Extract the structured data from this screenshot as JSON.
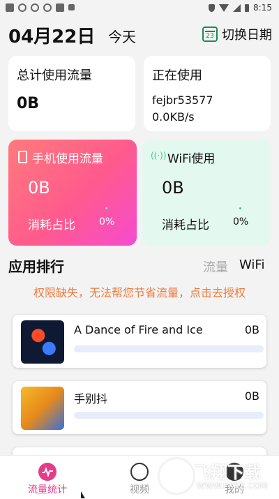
{
  "status_bar": {
    "time": "8:15"
  },
  "header": {
    "date": "04月22日",
    "today": "今天",
    "switch_label": "切换日期",
    "calendar_num": "23"
  },
  "total_card": {
    "title": "总计使用流量",
    "value": "0B"
  },
  "using_card": {
    "title": "正在使用",
    "network": "fejbr53577",
    "speed": "0.0KB/s"
  },
  "mobile_card": {
    "title": "手机使用流量",
    "value": "0B",
    "ratio_label": "消耗占比",
    "ratio_value": "0%"
  },
  "wifi_card": {
    "title": "WiFi使用",
    "value": "0B",
    "ratio_label": "消耗占比",
    "ratio_value": "0%"
  },
  "ranking": {
    "title": "应用排行",
    "tabs": [
      "流量",
      "WiFi"
    ],
    "warning": "权限缺失，无法帮您节省流量，点击去授权"
  },
  "apps": [
    {
      "name": "A Dance of Fire and Ice",
      "size": "0B"
    },
    {
      "name": "手别抖",
      "size": "0B"
    }
  ],
  "bottom_nav": [
    {
      "label": "流量统计",
      "color": "#e83a8a"
    },
    {
      "label": "视频"
    },
    {
      "label": "我的"
    }
  ],
  "watermark": {
    "text": "飞翔下载",
    "url": "WWW.FXXZ.COM"
  },
  "colors": {
    "accent_pink": "#e83a8a",
    "warning": "#f07a3a",
    "green": "#1a8a5a"
  }
}
